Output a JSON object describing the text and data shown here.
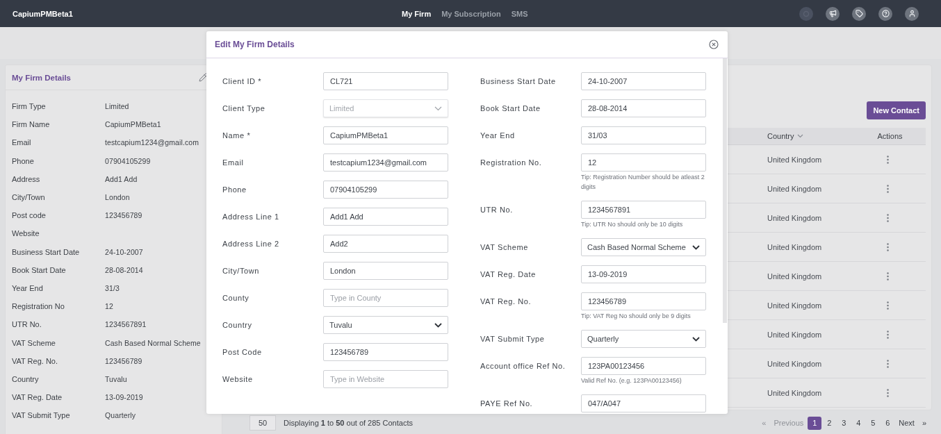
{
  "app": {
    "name": "CapiumPMBeta1"
  },
  "nav_links": [
    {
      "label": "My Firm",
      "selected": true
    },
    {
      "label": "My Subscription",
      "selected": false
    },
    {
      "label": "SMS",
      "selected": false
    }
  ],
  "firm_details": {
    "title": "My Firm Details",
    "rows": [
      {
        "label": "Firm Type",
        "value": "Limited"
      },
      {
        "label": "Firm Name",
        "value": "CapiumPMBeta1"
      },
      {
        "label": "Email",
        "value": "testcapium1234@gmail.com"
      },
      {
        "label": "Phone",
        "value": "07904105299"
      },
      {
        "label": "Address",
        "value": "Add1 Add"
      },
      {
        "label": "City/Town",
        "value": "London"
      },
      {
        "label": "Post code",
        "value": "123456789"
      },
      {
        "label": "Website"
      },
      {
        "label": "Business Start Date",
        "value": "24-10-2007"
      },
      {
        "label": "Book Start Date",
        "value": "28-08-2014"
      },
      {
        "label": "Year End",
        "value": "31/3"
      },
      {
        "label": "Registration No",
        "value": "12"
      },
      {
        "label": "UTR No.",
        "value": "1234567891"
      },
      {
        "label": "VAT Scheme",
        "value": "Cash Based Normal Scheme"
      },
      {
        "label": "VAT Reg. No.",
        "value": "123456789"
      },
      {
        "label": "Country",
        "value": "Tuvalu"
      },
      {
        "label": "VAT Reg. Date",
        "value": "13-09-2019"
      },
      {
        "label": "VAT Submit Type",
        "value": "Quarterly"
      }
    ]
  },
  "contacts": {
    "new_button": "New Contact",
    "columns": [
      "Country",
      "Actions"
    ],
    "rows": [
      {
        "country": "United Kingdom"
      },
      {
        "country": "United Kingdom"
      },
      {
        "country": "United Kingdom"
      },
      {
        "country": "United Kingdom"
      },
      {
        "country": "United Kingdom"
      },
      {
        "country": "United Kingdom"
      },
      {
        "country": "United Kingdom"
      },
      {
        "country": "United Kingdom"
      },
      {
        "country": "United Kingdom"
      }
    ],
    "page_size": "50",
    "summary": "Displaying **1** to **50** out of 285 Contacts",
    "pagination": {
      "previous_arrow": "«",
      "previous": "Previous",
      "pages": [
        {
          "label": "1",
          "selected": true
        },
        {
          "label": "2",
          "selected": false
        },
        {
          "label": "3",
          "selected": false
        },
        {
          "label": "4",
          "selected": false
        },
        {
          "label": "5",
          "selected": false
        },
        {
          "label": "6",
          "selected": false
        }
      ],
      "next": "Next",
      "next_arrow": "»"
    }
  },
  "modal": {
    "title": "Edit My Firm Details",
    "left_fields": [
      {
        "label": "Client ID *",
        "kind": "text",
        "value": "CL721",
        "disabled": false
      },
      {
        "label": "Client Type",
        "kind": "select",
        "value": "Limited",
        "disabled": true
      },
      {
        "label": "Name *",
        "kind": "text",
        "value": "CapiumPMBeta1",
        "disabled": false
      },
      {
        "label": "Email",
        "kind": "text",
        "value": "testcapium1234@gmail.com",
        "disabled": false
      },
      {
        "label": "Phone",
        "kind": "text",
        "value": "07904105299",
        "disabled": false
      },
      {
        "label": "Address Line 1",
        "kind": "text",
        "value": "Add1 Add",
        "disabled": false
      },
      {
        "label": "Address Line 2",
        "kind": "text",
        "value": "Add2",
        "disabled": false
      },
      {
        "label": "City/Town",
        "kind": "text",
        "value": "London",
        "disabled": false
      },
      {
        "label": "County",
        "kind": "text",
        "placeholder": "Type in County",
        "disabled": false
      },
      {
        "label": "Country",
        "kind": "select",
        "value": "Tuvalu",
        "disabled": false
      },
      {
        "label": "Post Code",
        "kind": "text",
        "value": "123456789",
        "disabled": false
      },
      {
        "label": "Website",
        "kind": "text",
        "placeholder": "Type in Website",
        "disabled": false
      }
    ],
    "right_fields": [
      {
        "label": "Business Start Date",
        "kind": "text",
        "value": "24-10-2007",
        "disabled": false
      },
      {
        "label": "Book Start Date",
        "kind": "text",
        "value": "28-08-2014",
        "disabled": false
      },
      {
        "label": "Year End",
        "kind": "text",
        "value": "31/03",
        "disabled": false
      },
      {
        "label": "Registration No.",
        "kind": "text",
        "value": "12",
        "tip": "Tip: Registration Number should be atleast 2 digits",
        "disabled": false
      },
      {
        "label": "UTR No.",
        "kind": "text",
        "value": "1234567891",
        "tip": "Tip: UTR No should only be 10 digits",
        "disabled": false
      },
      {
        "label": "VAT Scheme",
        "kind": "select",
        "value": "Cash Based Normal Scheme",
        "disabled": false
      },
      {
        "label": "VAT Reg. Date",
        "kind": "text",
        "value": "13-09-2019",
        "disabled": false
      },
      {
        "label": "VAT Reg. No.",
        "kind": "text",
        "value": "123456789",
        "tip": "Tip: VAT Reg No should only be 9 digits",
        "disabled": false
      },
      {
        "label": "VAT Submit Type",
        "kind": "select",
        "value": "Quarterly",
        "disabled": false
      },
      {
        "label": "Account office Ref No.",
        "kind": "text",
        "value": "123PA00123456",
        "tip": "Valid Ref No. (e.g. 123PA00123456)",
        "disabled": false
      },
      {
        "label": "PAYE Ref No.",
        "kind": "text",
        "value": "047/A047",
        "disabled": false
      }
    ]
  }
}
